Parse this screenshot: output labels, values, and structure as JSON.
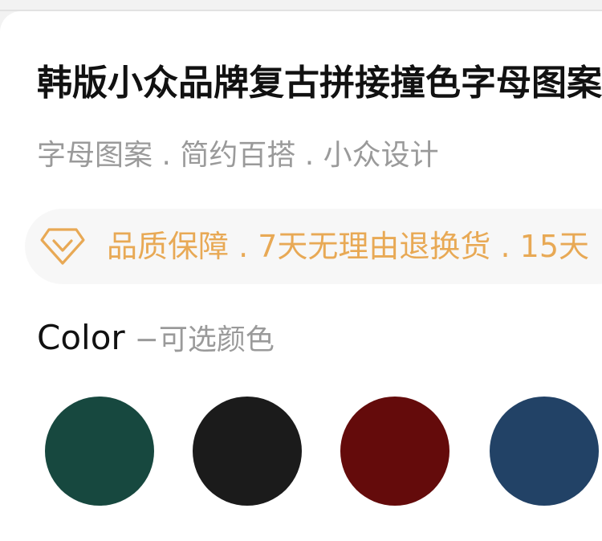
{
  "product": {
    "title": "韩版小众品牌复古拼接撞色字母图案",
    "subtitle": "字母图案 . 简约百搭 . 小众设计"
  },
  "guarantee": {
    "icon": "diamond-icon",
    "text": "品质保障 . 7天无理由退换货 . 15天",
    "accent_color": "#e8a955"
  },
  "color_section": {
    "label": "Color",
    "sublabel": "−可选颜色",
    "swatches": [
      {
        "name": "dark-green",
        "hex": "#17483f"
      },
      {
        "name": "black",
        "hex": "#1b1b1b"
      },
      {
        "name": "dark-red",
        "hex": "#640b0b"
      },
      {
        "name": "navy-blue",
        "hex": "#224266"
      }
    ]
  }
}
